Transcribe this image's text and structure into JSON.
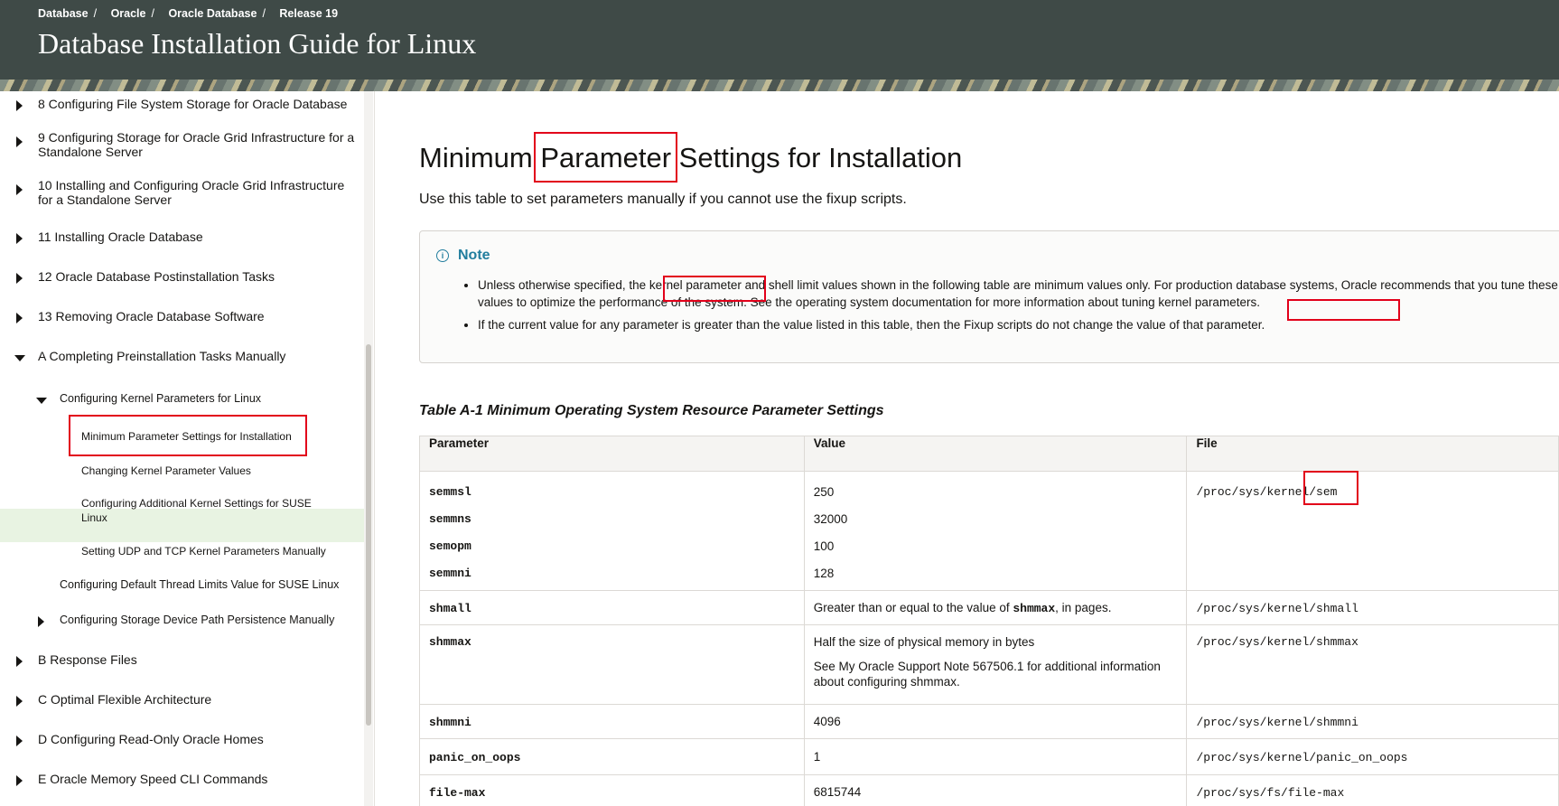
{
  "header": {
    "breadcrumb": [
      "Database",
      "Oracle",
      "Oracle Database",
      "Release 19"
    ],
    "separator": "/",
    "book_title": "Database Installation Guide for Linux"
  },
  "sidebar": {
    "items": [
      {
        "label": "8  Configuring File System Storage for Oracle Database"
      },
      {
        "label": "9  Configuring Storage for Oracle Grid Infrastructure for a Standalone Server"
      },
      {
        "label": "10  Installing and Configuring Oracle Grid Infrastructure for a Standalone Server"
      },
      {
        "label": "11  Installing Oracle Database"
      },
      {
        "label": "12  Oracle Database Postinstallation Tasks"
      },
      {
        "label": "13  Removing Oracle Database Software"
      },
      {
        "label": "A  Completing Preinstallation Tasks Manually"
      },
      {
        "label": "Configuring Kernel Parameters for Linux"
      },
      {
        "label": "Minimum Parameter Settings for Installation"
      },
      {
        "label": "Changing Kernel Parameter Values"
      },
      {
        "label": "Configuring Additional Kernel Settings for SUSE Linux"
      },
      {
        "label": "Setting UDP and TCP Kernel Parameters Manually"
      },
      {
        "label": "Configuring Default Thread Limits Value for SUSE Linux"
      },
      {
        "label": "Configuring Storage Device Path Persistence Manually"
      },
      {
        "label": "B  Response Files"
      },
      {
        "label": "C  Optimal Flexible Architecture"
      },
      {
        "label": "D  Configuring Read-Only Oracle Homes"
      },
      {
        "label": "E  Oracle Memory Speed CLI Commands"
      }
    ]
  },
  "main": {
    "title": "Minimum Parameter Settings for Installation",
    "intro": "Use this table to set parameters manually if you cannot use the fixup scripts.",
    "note": {
      "heading": "Note",
      "bullets": [
        "Unless otherwise specified, the kernel parameter and shell limit values shown in the following table are minimum values only. For production database systems, Oracle recommends that you tune these values to optimize the performance of the system. See the operating system documentation for more information about tuning kernel parameters.",
        "If the current value for any parameter is greater than the value listed in this table, then the Fixup scripts do not change the value of that parameter."
      ]
    },
    "table_caption": "Table A-1 Minimum Operating System Resource Parameter Settings",
    "table": {
      "headers": [
        "Parameter",
        "Value",
        "File"
      ],
      "rows": [
        {
          "params": [
            "semmsl",
            "semmns",
            "semopm",
            "semmni"
          ],
          "values": [
            "250",
            "32000",
            "100",
            "128"
          ],
          "file": "/proc/sys/kernel/sem"
        },
        {
          "param": "shmall",
          "value_pre": "Greater than or equal to the value of ",
          "value_code": "shmmax",
          "value_post": ", in pages.",
          "file": "/proc/sys/kernel/shmall"
        },
        {
          "param": "shmmax",
          "value_line1": "Half the size of physical memory in bytes",
          "value_line2": "See My Oracle Support Note 567506.1 for additional information about configuring shmmax.",
          "file": "/proc/sys/kernel/shmmax"
        },
        {
          "param": "shmmni",
          "value": "4096",
          "file": "/proc/sys/kernel/shmmni"
        },
        {
          "param": "panic_on_oops",
          "value": "1",
          "file": "/proc/sys/kernel/panic_on_oops"
        },
        {
          "param": "file-max",
          "value": "6815744",
          "file": "/proc/sys/fs/file-max"
        }
      ]
    }
  }
}
